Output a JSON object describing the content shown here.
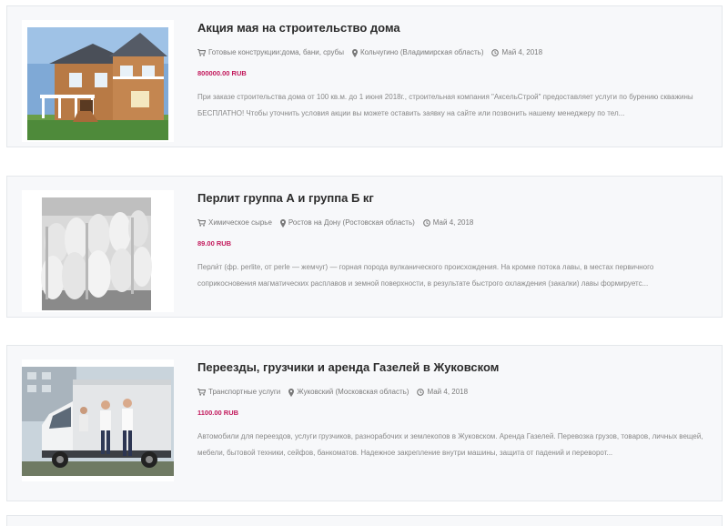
{
  "listings": [
    {
      "title": "Акция мая на строительство дома",
      "category": "Готовые конструкции:дома, бани, срубы",
      "location": "Кольчугино (Владимирская область)",
      "date": "Май 4, 2018",
      "price": "800000.00 RUB",
      "description": "При заказе строительства дома от 100 кв.м. до 1 июня 2018г., строительная компания \"АксельСтрой\" предоставляет услуги по бурению скважины БЕСПЛАТНО! Чтобы уточнить условия акции вы можете оставить заявку на сайте или позвонить нашему менеджеру по тел...",
      "image_icon": "house-photo"
    },
    {
      "title": "Перлит группа А и группа Б кг",
      "category": "Химическое сырье",
      "location": "Ростов на Дону (Ростовская область)",
      "date": "Май 4, 2018",
      "price": "89.00 RUB",
      "description": "Перли́т (фр. perlite, от perle — жемчуг) — горная порода вулканического происхождения. На кромке потока лавы, в местах первичного соприкосновения магматических расплавов и земной поверхности, в результате быстрого охлаждения (закалки) лавы формируетс...",
      "image_icon": "bags-photo"
    },
    {
      "title": "Переезды, грузчики и аренда Газелей в Жуковском",
      "category": "Транспортные услуги",
      "location": "Жуковский (Московская область)",
      "date": "Май 4, 2018",
      "price": "1100.00 RUB",
      "description": "Автомобили для переездов, услуги грузчиков, разнорабочих и землекопов в Жуковском. Аренда Газелей. Перевозка грузов, товаров, личных вещей, мебели, бытовой техники, сейфов, банкоматов. Надежное закрепление внутри машины, защита от падений и переворот...",
      "image_icon": "truck-photo"
    }
  ],
  "icons": {
    "category": "cart-icon",
    "location": "map-marker-icon",
    "date": "clock-icon"
  },
  "colors": {
    "price": "#c2185b",
    "card_background": "#f7f8fa",
    "title": "#2b2b2b"
  }
}
